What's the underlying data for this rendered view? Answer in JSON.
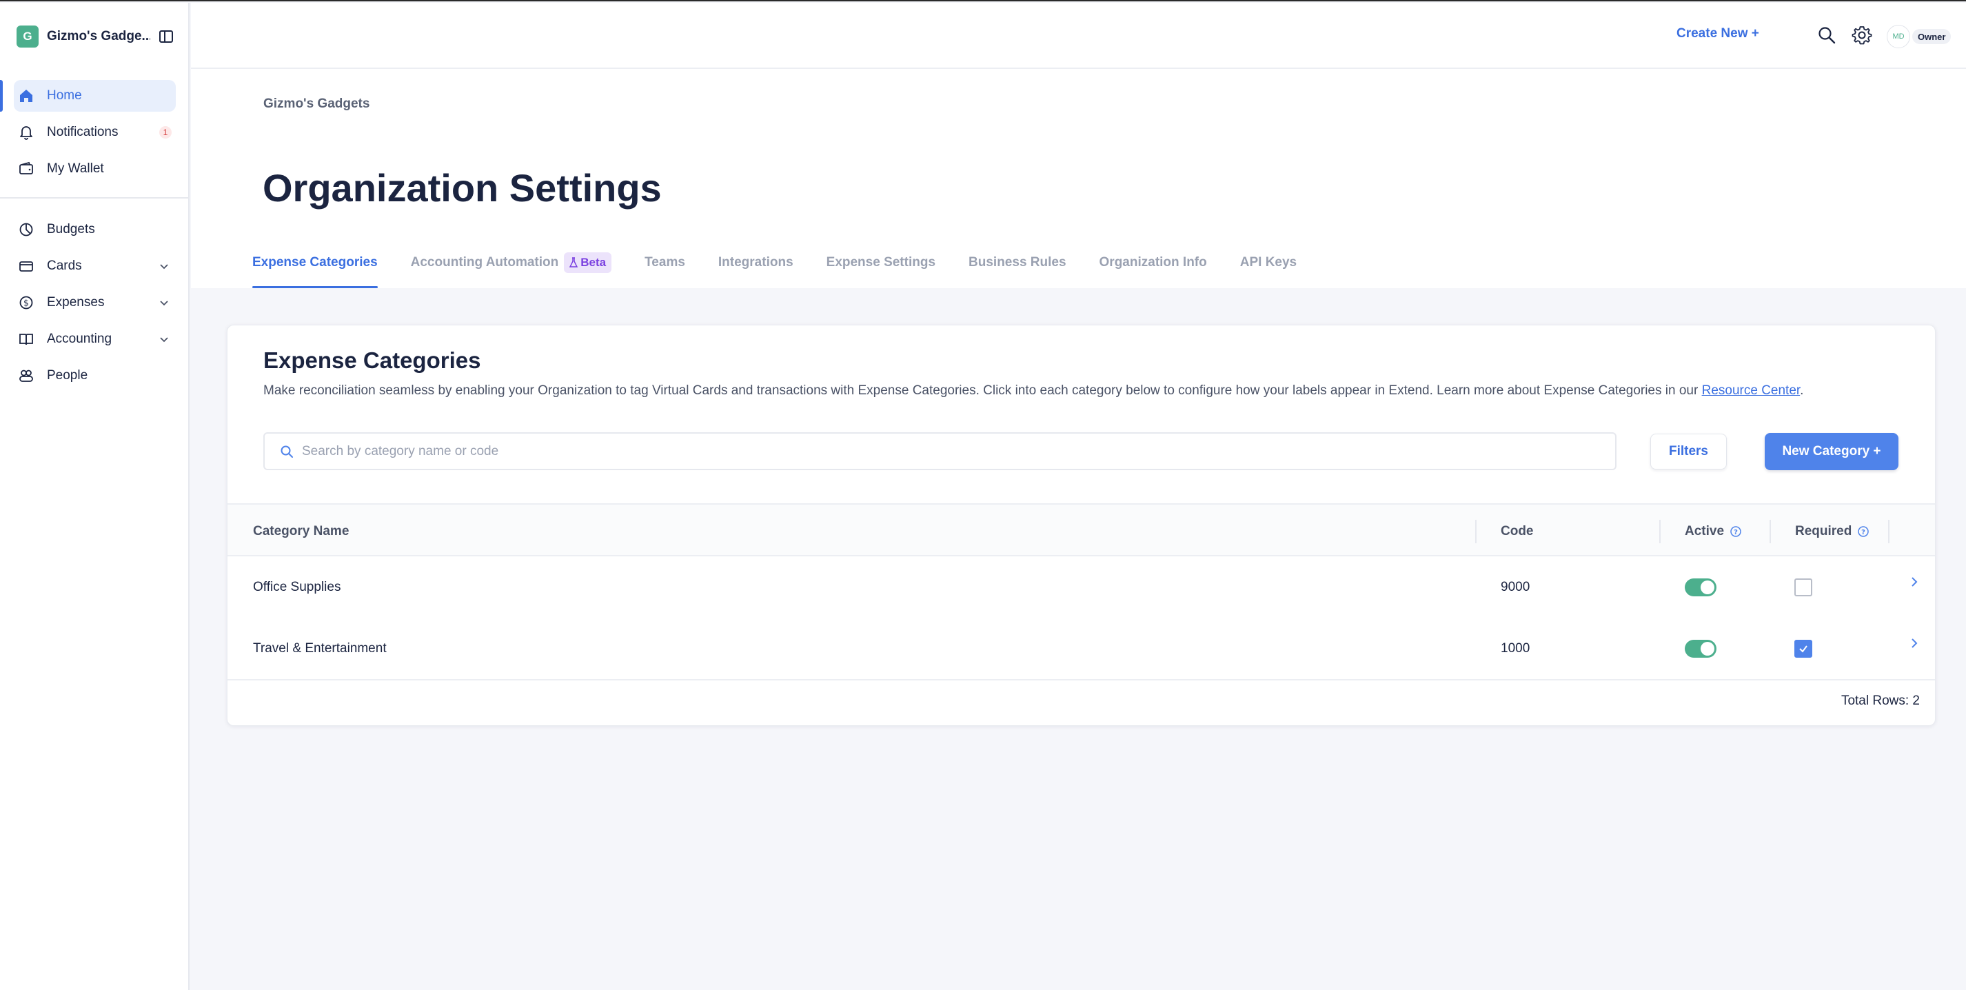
{
  "colors": {
    "accent": "#3b6fe0",
    "primary_button": "#4f83ea",
    "toggle_on": "#4caf8d",
    "org_badge": "#4caf8d",
    "beta_badge_bg": "#ece3fb",
    "beta_badge_text": "#7a3fe0",
    "notification_badge": "#d53b3b"
  },
  "sidebar": {
    "org_initial": "G",
    "org_name": "Gizmo's Gadge...",
    "collapse_icon": "sidebar-collapse-icon",
    "items_primary": [
      {
        "label": "Home",
        "icon": "home-icon",
        "active": true
      },
      {
        "label": "Notifications",
        "icon": "bell-icon",
        "badge": "1"
      },
      {
        "label": "My Wallet",
        "icon": "wallet-icon"
      }
    ],
    "items_secondary": [
      {
        "label": "Budgets",
        "icon": "pie-chart-icon"
      },
      {
        "label": "Cards",
        "icon": "credit-card-icon",
        "expandable": true
      },
      {
        "label": "Expenses",
        "icon": "dollar-circle-icon",
        "expandable": true
      },
      {
        "label": "Accounting",
        "icon": "book-icon",
        "expandable": true
      },
      {
        "label": "People",
        "icon": "people-icon"
      }
    ]
  },
  "topbar": {
    "create_new_label": "Create New +",
    "search_icon": "search-icon",
    "settings_icon": "gear-icon",
    "avatar_initials": "MD",
    "role": "Owner"
  },
  "header": {
    "breadcrumb": "Gizmo's Gadgets",
    "title": "Organization Settings",
    "tabs": [
      {
        "label": "Expense Categories",
        "active": true
      },
      {
        "label": "Accounting Automation",
        "badge": "Beta",
        "badge_icon": "flask-icon"
      },
      {
        "label": "Teams"
      },
      {
        "label": "Integrations"
      },
      {
        "label": "Expense Settings"
      },
      {
        "label": "Business Rules"
      },
      {
        "label": "Organization Info"
      },
      {
        "label": "API Keys"
      }
    ]
  },
  "main": {
    "title": "Expense Categories",
    "description": "Make reconciliation seamless by enabling your Organization to tag Virtual Cards and transactions with Expense Categories. Click into each category below to configure how your labels appear in Extend. Learn more about Expense Categories in our",
    "description_link": "Resource Center",
    "description_end": ".",
    "search": {
      "placeholder": "Search by category name or code",
      "value": ""
    },
    "filters_label": "Filters",
    "new_category_label": "New Category +",
    "table": {
      "columns": [
        "Category Name",
        "Code",
        "Active",
        "Required"
      ],
      "rows": [
        {
          "name": "Office Supplies",
          "code": "9000",
          "active": true,
          "required": false
        },
        {
          "name": "Travel & Entertainment",
          "code": "1000",
          "active": true,
          "required": true
        }
      ]
    },
    "total_rows_label": "Total Rows: 2"
  }
}
